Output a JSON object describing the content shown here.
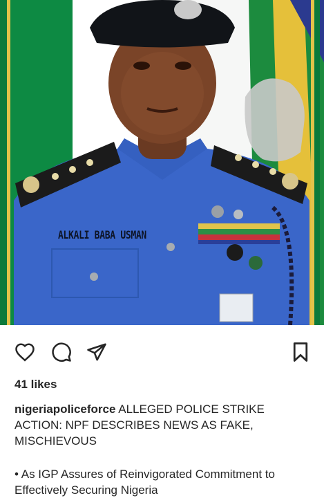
{
  "post": {
    "image_alt": "Portrait of police officer in blue uniform and black cap in front of flags",
    "name_tag": "ALKALI BABA USMAN"
  },
  "actions": {
    "like_icon": "heart-icon",
    "comment_icon": "comment-icon",
    "share_icon": "send-icon",
    "save_icon": "bookmark-icon"
  },
  "likes": "41 likes",
  "caption": {
    "username": "nigeriapoliceforce",
    "text": "ALLEGED POLICE STRIKE ACTION: NPF DESCRIBES NEWS AS FAKE, MISCHIEVOUS",
    "bullet": "• As IGP Assures of Reinvigorated Commitment to Effectively Securing Nigeria"
  },
  "colors": {
    "flag_green": "#0b7a3b",
    "uniform_blue": "#3a66c9",
    "text": "#262626"
  }
}
